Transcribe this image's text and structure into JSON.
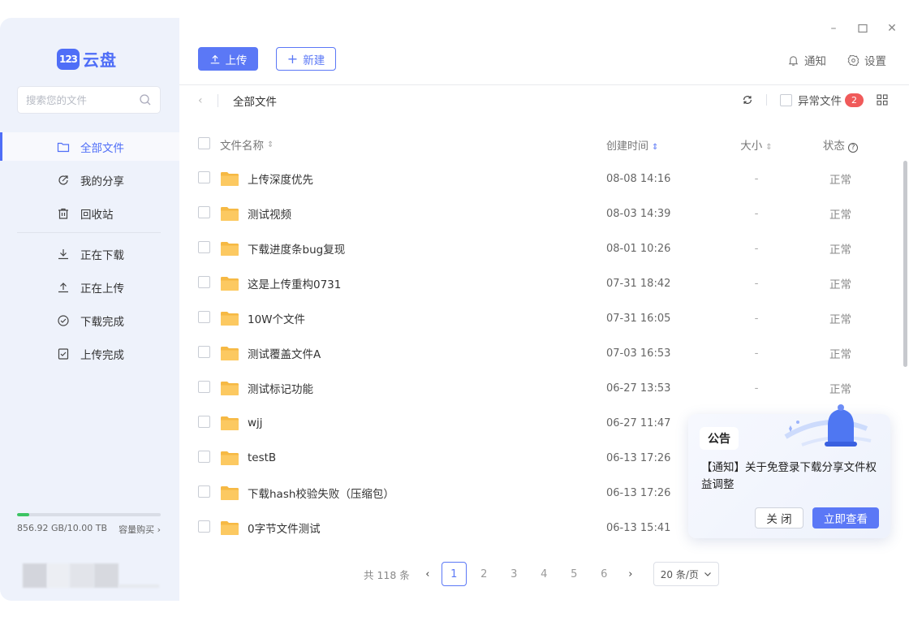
{
  "app": {
    "logo_badge": "123",
    "logo_text": "云盘"
  },
  "search": {
    "placeholder": "搜索您的文件"
  },
  "sidebar": {
    "items": [
      {
        "label": "全部文件",
        "icon": "folder-icon",
        "active": true
      },
      {
        "label": "我的分享",
        "icon": "share-icon"
      },
      {
        "label": "回收站",
        "icon": "trash-icon"
      },
      {
        "label": "正在下载",
        "icon": "download-icon"
      },
      {
        "label": "正在上传",
        "icon": "upload-icon"
      },
      {
        "label": "下载完成",
        "icon": "check-circle-icon"
      },
      {
        "label": "上传完成",
        "icon": "check-square-icon"
      }
    ],
    "storage": {
      "text": "856.92 GB/10.00 TB",
      "used_fraction": 0.084,
      "buy_label": "容量购买",
      "bar_color": "#3cc463"
    }
  },
  "toolbar": {
    "upload_label": "上传",
    "new_label": "新建",
    "notify_label": "通知",
    "settings_label": "设置"
  },
  "breadcrumb": {
    "title": "全部文件",
    "abnormal_label": "异常文件",
    "abnormal_count": "2"
  },
  "table": {
    "headers": {
      "name": "文件名称",
      "time": "创建时间",
      "size": "大小",
      "status": "状态"
    },
    "rows": [
      {
        "name": "上传深度优先",
        "time": "08-08 14:16",
        "size": "-",
        "status": "正常"
      },
      {
        "name": "测试视频",
        "time": "08-03 14:39",
        "size": "-",
        "status": "正常"
      },
      {
        "name": "下载进度条bug复现",
        "time": "08-01 10:26",
        "size": "-",
        "status": "正常"
      },
      {
        "name": "这是上传重构0731",
        "time": "07-31 18:42",
        "size": "-",
        "status": "正常"
      },
      {
        "name": "10W个文件",
        "time": "07-31 16:05",
        "size": "-",
        "status": "正常"
      },
      {
        "name": "测试覆盖文件A",
        "time": "07-03 16:53",
        "size": "-",
        "status": "正常"
      },
      {
        "name": "测试标记功能",
        "time": "06-27 13:53",
        "size": "-",
        "status": "正常"
      },
      {
        "name": "wjj",
        "time": "06-27 11:47",
        "size": "",
        "status": ""
      },
      {
        "name": "testB",
        "time": "06-13 17:26",
        "size": "",
        "status": ""
      },
      {
        "name": "下载hash校验失败（压缩包）",
        "time": "06-13 17:26",
        "size": "",
        "status": ""
      },
      {
        "name": "0字节文件测试",
        "time": "06-13 15:41",
        "size": "",
        "status": ""
      }
    ]
  },
  "pagination": {
    "total": "共 118 条",
    "pages": [
      "1",
      "2",
      "3",
      "4",
      "5",
      "6"
    ],
    "current": "1",
    "per_page": "20 条/页"
  },
  "notice": {
    "tag": "公告",
    "message": "【通知】关于免登录下载分享文件权益调整",
    "close_label": "关 闭",
    "view_label": "立即查看"
  },
  "colors": {
    "accent": "#5b78f6",
    "badge": "#f05a5a",
    "folder": "#fbc75a"
  }
}
